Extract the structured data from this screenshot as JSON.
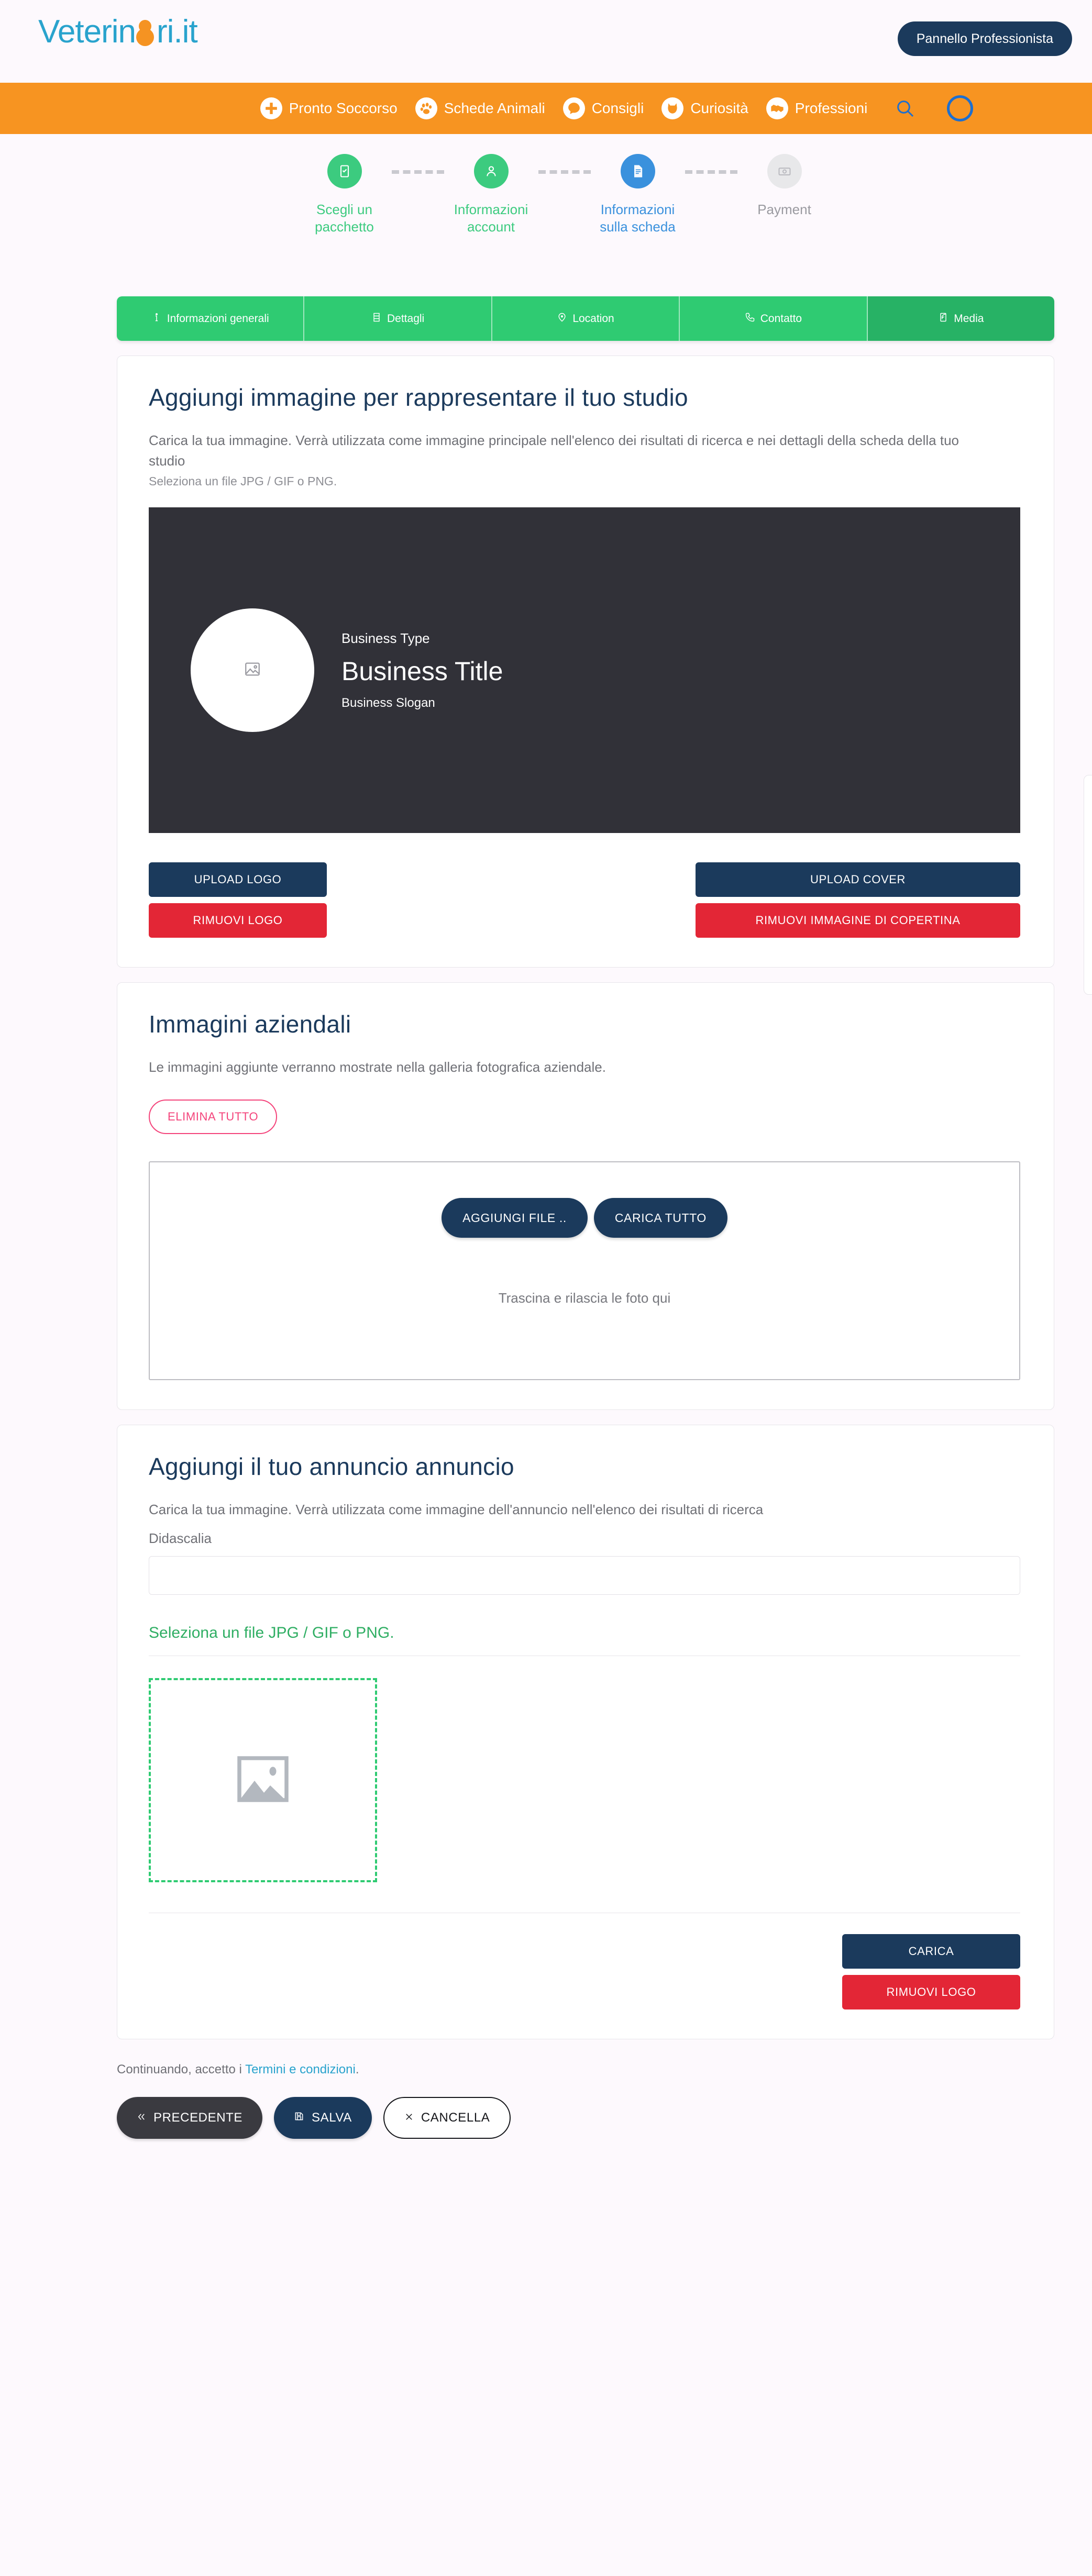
{
  "header": {
    "logo_text_1": "Veterin",
    "logo_text_2": "ri",
    "logo_text_3": ".it",
    "panel_button": "Pannello Professionista"
  },
  "nav": {
    "items": [
      {
        "label": "Pronto Soccorso",
        "icon": "plus-cross-icon"
      },
      {
        "label": "Schede Animali",
        "icon": "paw-icon"
      },
      {
        "label": "Consigli",
        "icon": "speech-bubble-icon"
      },
      {
        "label": "Curiosità",
        "icon": "cat-icon"
      },
      {
        "label": "Professioni",
        "icon": "handshake-icon"
      }
    ],
    "search_icon": "search-icon",
    "avatar": "user-avatar",
    "bg_color": "#f79421"
  },
  "stepper": {
    "steps": [
      {
        "label": "Scegli un pacchetto",
        "state": "done",
        "icon": "package-icon"
      },
      {
        "label": "Informazioni account",
        "state": "done",
        "icon": "user-icon"
      },
      {
        "label": "Informazioni sulla scheda",
        "state": "active",
        "icon": "document-icon"
      },
      {
        "label": "Payment",
        "state": "todo",
        "icon": "money-icon"
      }
    ],
    "color_done": "#3ccb7f",
    "color_active": "#3a91dd",
    "color_todo": "#9a9aa0"
  },
  "tabs": [
    {
      "label": "Informazioni generali",
      "icon": "info-icon",
      "active": false
    },
    {
      "label": "Dettagli",
      "icon": "list-icon",
      "active": false
    },
    {
      "label": "Location",
      "icon": "map-pin-icon",
      "active": false
    },
    {
      "label": "Contatto",
      "icon": "phone-icon",
      "active": false
    },
    {
      "label": "Media",
      "icon": "media-icon",
      "active": true
    }
  ],
  "card_image": {
    "title": "Aggiungi immagine per rappresentare il tuo studio",
    "description": "Carica la tua immagine. Verrà utilizzata come immagine principale nell'elenco dei risultati di ricerca e nei dettagli della scheda della tuo studio",
    "sub": "Seleziona un file JPG / GIF o PNG.",
    "preview": {
      "business_type": "Business Type",
      "business_title": "Business Title",
      "business_slogan": "Business Slogan",
      "logo_placeholder_icon": "image-placeholder-icon",
      "bg_color": "#313138"
    },
    "upload_logo": "UPLOAD LOGO",
    "remove_logo": "RIMUOVI LOGO",
    "upload_cover": "UPLOAD COVER",
    "remove_cover": "RIMUOVI IMMAGINE DI COPERTINA"
  },
  "card_gallery": {
    "title": "Immagini aziendali",
    "description": "Le immagini aggiunte verranno mostrate nella galleria fotografica aziendale.",
    "delete_all": "ELIMINA TUTTO",
    "add_files": "AGGIUNGI FILE ..",
    "upload_all": "CARICA TUTTO",
    "drop_hint": "Trascina e rilascia le foto qui"
  },
  "card_ad": {
    "title": "Aggiungi il tuo annuncio annuncio",
    "description": "Carica la tua immagine. Verrà utilizzata come immagine dell'annuncio nell'elenco dei risultati di ricerca",
    "caption_label": "Didascalia",
    "caption_value": "",
    "caption_placeholder": "",
    "select_file_link": "Seleziona un file JPG / GIF o PNG.",
    "placeholder_icon": "image-placeholder-icon",
    "upload": "CARICA",
    "remove": "RIMUOVI LOGO"
  },
  "footer": {
    "terms_prefix": "Continuando, accetto i ",
    "terms_link": "Termini e condizioni",
    "terms_suffix": ".",
    "previous": "PRECEDENTE",
    "save": "SALVA",
    "cancel": "CANCELLA"
  },
  "colors": {
    "navy": "#1b3a5c",
    "red": "#e32636",
    "green": "#2fcb72",
    "green_active": "#27b265",
    "orange": "#f79421",
    "blue": "#29a3cd",
    "pink": "#f4447b",
    "page_bg": "#fdf9fd"
  }
}
